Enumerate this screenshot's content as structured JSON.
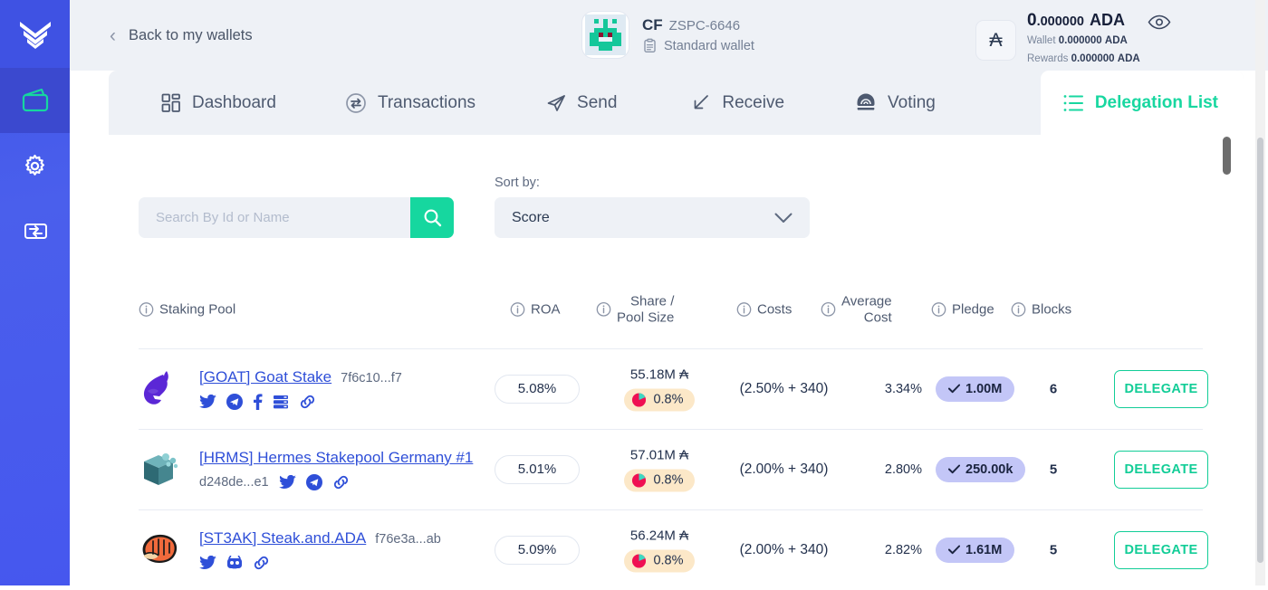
{
  "sidebar": {
    "logo_icon": "yoroi-chevrons-logo",
    "items": [
      {
        "icon": "wallet-icon",
        "name": "wallets",
        "active": true
      },
      {
        "icon": "gear-icon",
        "name": "settings",
        "active": false
      },
      {
        "icon": "transfer-wallet-icon",
        "name": "transfer",
        "active": false
      }
    ]
  },
  "header": {
    "back_label": "Back to my wallets",
    "back_icon": "chevron-left-icon",
    "wallet": {
      "avatar_icon": "pixel-identicon",
      "abbreviation": "CF",
      "id": "ZSPC-6646",
      "type_icon": "clipboard-icon",
      "type_label": "Standard wallet"
    },
    "currency_button": {
      "glyph": "₳",
      "icon": "ada-symbol-icon"
    },
    "balance": {
      "integer": "0",
      "decimals": ".000000",
      "unit": "ADA",
      "wallet_label": "Wallet",
      "wallet_amount": "0.000000",
      "wallet_unit": "ADA",
      "rewards_label": "Rewards",
      "rewards_amount": "0.000000",
      "rewards_unit": "ADA"
    },
    "eye_icon": "eye-icon",
    "caret_icon": "caret-down-icon"
  },
  "tabs": [
    {
      "label": "Dashboard",
      "icon": "dashboard-grid-icon",
      "active": false
    },
    {
      "label": "Transactions",
      "icon": "transactions-swap-icon",
      "active": false
    },
    {
      "label": "Send",
      "icon": "send-paper-plane-icon",
      "active": false
    },
    {
      "label": "Receive",
      "icon": "receive-arrow-icon",
      "active": false
    },
    {
      "label": "Voting",
      "icon": "voting-ballot-icon",
      "active": false
    },
    {
      "label": "Delegation List",
      "icon": "list-icon",
      "active": true
    }
  ],
  "controls": {
    "search": {
      "placeholder": "Search By Id or Name",
      "value": "",
      "button_icon": "search-icon"
    },
    "sort": {
      "label": "Sort by:",
      "value": "Score",
      "chevron_icon": "chevron-down-icon"
    }
  },
  "table": {
    "headers": [
      {
        "label": "Staking Pool",
        "info_icon": "info-icon"
      },
      {
        "label": "ROA",
        "info_icon": "info-icon"
      },
      {
        "label": "Share /\nPool Size",
        "line1": "Share /",
        "line2": "Pool Size",
        "info_icon": "info-icon"
      },
      {
        "label": "Costs",
        "info_icon": "info-icon"
      },
      {
        "label": "Average\nCost",
        "line1": "Average",
        "line2": "Cost",
        "info_icon": "info-icon"
      },
      {
        "label": "Pledge",
        "info_icon": "info-icon"
      },
      {
        "label": "Blocks",
        "info_icon": "info-icon"
      }
    ],
    "rows": [
      {
        "logo_icon": "goat-logo",
        "name": "[GOAT] Goat Stake",
        "hash": "7f6c10...f7",
        "hash_inline": true,
        "socials": [
          "twitter-icon",
          "telegram-icon",
          "facebook-icon",
          "server-icon",
          "link-icon"
        ],
        "roa": "5.08%",
        "pool_size": "55.18M ₳",
        "share": "0.8%",
        "costs": "(2.50% + 340)",
        "average_cost": "3.34%",
        "pledge": "1.00M",
        "blocks": "6",
        "delegate_label": "DELEGATE"
      },
      {
        "logo_icon": "hermes-box-logo",
        "name": "[HRMS] Hermes Stakepool Germany #1",
        "hash": "d248de...e1",
        "hash_inline": false,
        "socials": [
          "twitter-icon",
          "telegram-icon",
          "link-icon"
        ],
        "roa": "5.01%",
        "pool_size": "57.01M ₳",
        "share": "0.8%",
        "costs": "(2.00% + 340)",
        "average_cost": "2.80%",
        "pledge": "250.00k",
        "blocks": "5",
        "delegate_label": "DELEGATE"
      },
      {
        "logo_icon": "steak-logo",
        "name": "[ST3AK] Steak.and.ADA",
        "hash": "f76e3a...ab",
        "hash_inline": true,
        "socials": [
          "twitter-icon",
          "github-icon",
          "link-icon"
        ],
        "roa": "5.09%",
        "pool_size": "56.24M ₳",
        "share": "0.8%",
        "costs": "(2.00% + 340)",
        "average_cost": "2.82%",
        "pledge": "1.61M",
        "blocks": "5",
        "delegate_label": "DELEGATE"
      }
    ]
  },
  "colors": {
    "accent_teal": "#16d79f",
    "sidebar_blue": "#4a5fec",
    "link_blue": "#2f4fd8",
    "badge_cream": "#fce8c8",
    "badge_lavender": "#c3c6f7",
    "header_bg": "#eef1f6"
  }
}
